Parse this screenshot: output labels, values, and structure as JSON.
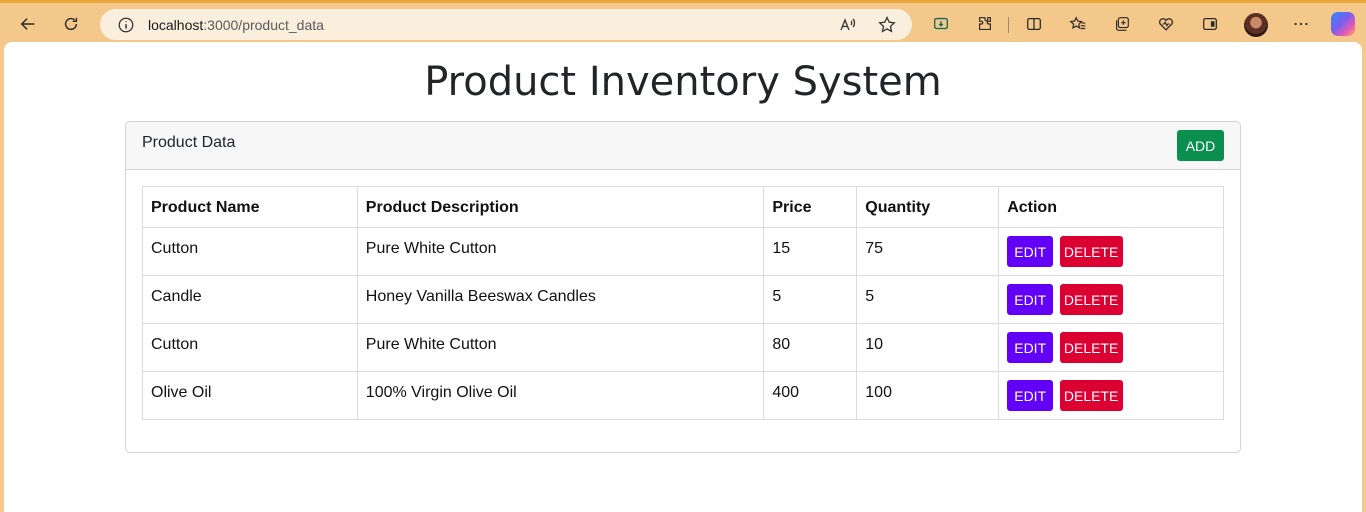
{
  "browser": {
    "url_host": "localhost",
    "url_path": ":3000/product_data"
  },
  "page": {
    "title": "Product Inventory System",
    "card_title": "Product Data",
    "add_label": "ADD"
  },
  "table": {
    "headers": [
      "Product Name",
      "Product Description",
      "Price",
      "Quantity",
      "Action"
    ],
    "rows": [
      {
        "name": "Cutton",
        "description": "Pure White Cutton",
        "price": "15",
        "quantity": "75"
      },
      {
        "name": "Candle",
        "description": "Honey Vanilla Beeswax Candles",
        "price": "5",
        "quantity": "5"
      },
      {
        "name": "Cutton",
        "description": "Pure White Cutton",
        "price": "80",
        "quantity": "10"
      },
      {
        "name": "Olive Oil",
        "description": "100% Virgin Olive Oil",
        "price": "400",
        "quantity": "100"
      }
    ],
    "edit_label": "EDIT",
    "delete_label": "DELETE"
  },
  "colors": {
    "add": "#0b8f4f",
    "edit": "#6200f7",
    "delete": "#dc0032",
    "browser_frame": "#f4c78b"
  }
}
